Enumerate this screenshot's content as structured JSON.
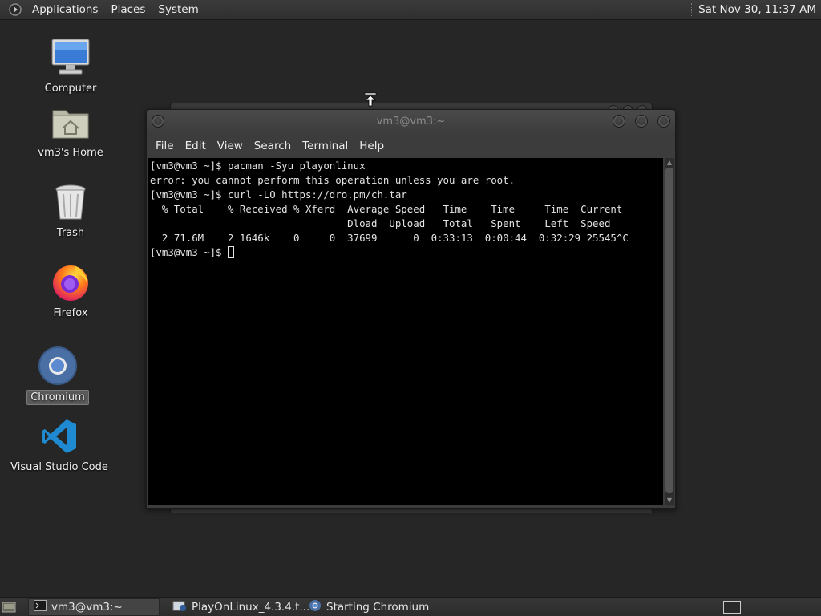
{
  "top_panel": {
    "menus": [
      "Applications",
      "Places",
      "System"
    ],
    "clock": "Sat Nov 30, 11:37 AM"
  },
  "desktop_icons": [
    {
      "label": "Computer",
      "icon": "computer-icon"
    },
    {
      "label": "vm3's Home",
      "icon": "home-folder-icon"
    },
    {
      "label": "Trash",
      "icon": "trash-icon"
    },
    {
      "label": "Firefox",
      "icon": "firefox-icon"
    },
    {
      "label": "Chromium",
      "icon": "chromium-icon",
      "selected": true
    },
    {
      "label": "Visual Studio Code",
      "icon": "vscode-icon"
    }
  ],
  "terminal": {
    "title": "vm3@vm3:~",
    "menu": [
      "File",
      "Edit",
      "View",
      "Search",
      "Terminal",
      "Help"
    ],
    "lines": [
      "[vm3@vm3 ~]$ pacman -Syu playonlinux",
      "error: you cannot perform this operation unless you are root.",
      "[vm3@vm3 ~]$ curl -LO https://dro.pm/ch.tar",
      "  % Total    % Received % Xferd  Average Speed   Time    Time     Time  Current",
      "                                 Dload  Upload   Total   Spent    Left  Speed",
      "  2 71.6M    2 1646k    0     0  37699      0  0:33:13  0:00:44  0:32:29 25545^C"
    ],
    "prompt": "[vm3@vm3 ~]$ "
  },
  "taskbar": {
    "tasks": [
      {
        "label": "vm3@vm3:~",
        "icon": "terminal-icon",
        "active": true
      },
      {
        "label": "PlayOnLinux_4.3.4.t...",
        "icon": "archive-icon",
        "active": false
      },
      {
        "label": "Starting Chromium",
        "icon": "chromium-icon",
        "active": false
      }
    ]
  },
  "colors": {
    "desktop_bg": "#262626",
    "panel_bg": "#333333",
    "terminal_bg": "#000000",
    "terminal_fg": "#e4e4e4"
  }
}
